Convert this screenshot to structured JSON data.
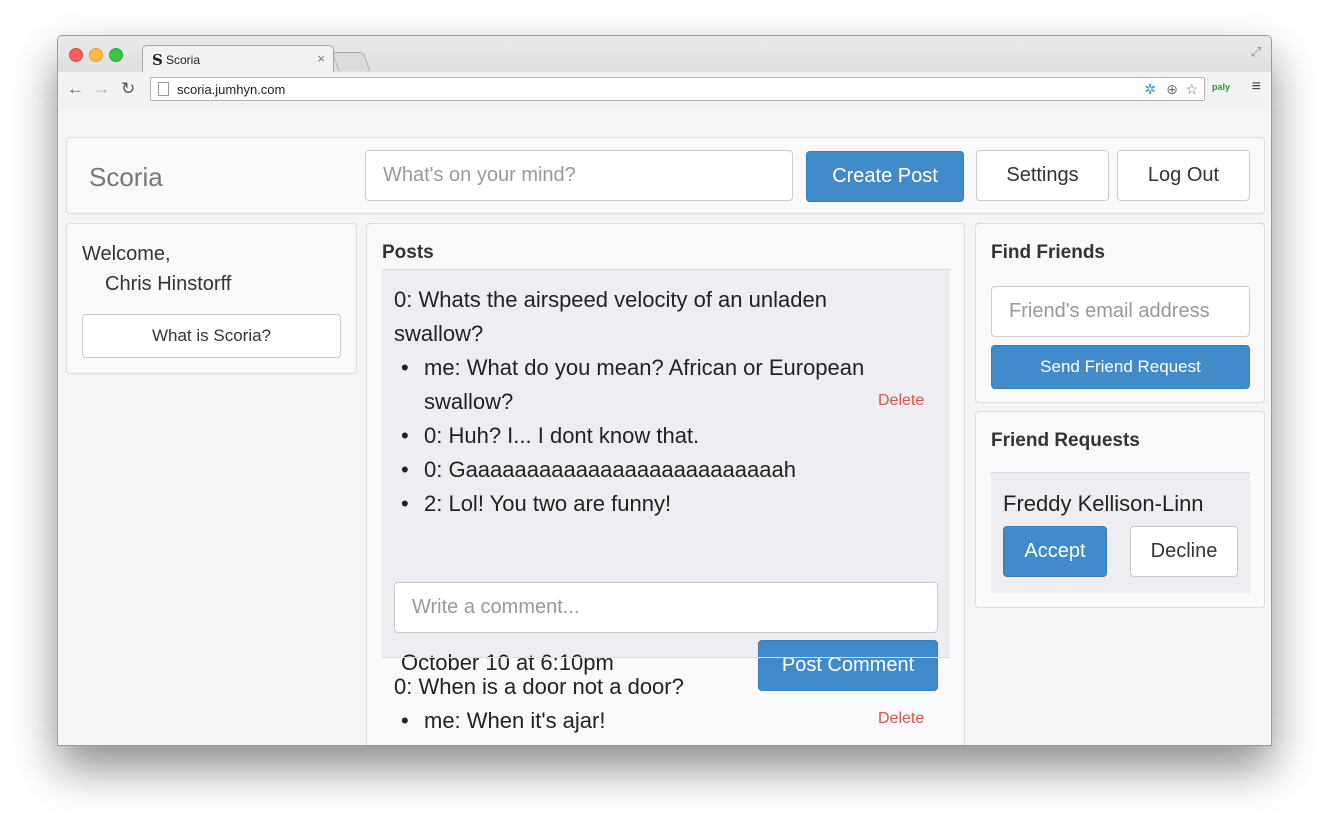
{
  "browser": {
    "tab_favicon": "S",
    "tab_title": "Scoria",
    "tab_close": "×",
    "url": "scoria.jumhyn.com",
    "extension_label": "paly"
  },
  "navbar": {
    "brand": "Scoria",
    "post_placeholder": "What's on your mind?",
    "create_post_label": "Create Post",
    "settings_label": "Settings",
    "logout_label": "Log Out"
  },
  "sidebar": {
    "welcome": "Welcome,",
    "user_name": "Chris Hinstorff",
    "about_button": "What is Scoria?"
  },
  "posts": {
    "title": "Posts",
    "items": [
      {
        "text": "0: Whats the airspeed velocity of an unladen swallow?",
        "comments": [
          {
            "text": "me: What do you mean? African or European swallow?",
            "delete_label": "Delete"
          },
          {
            "text": "0: Huh? I... I dont know that."
          },
          {
            "text": "0: Gaaaaaaaaaaaaaaaaaaaaaaaaaah"
          },
          {
            "text": "2: Lol! You two are funny!"
          }
        ],
        "comment_placeholder": "Write a comment...",
        "date": "October 10 at 6:10pm",
        "post_comment_label": "Post Comment"
      },
      {
        "text": "0: When is a door not a door?",
        "comments": [
          {
            "text": "me: When it's ajar!",
            "delete_label": "Delete"
          }
        ]
      }
    ]
  },
  "find_friends": {
    "title": "Find Friends",
    "email_placeholder": "Friend's email address",
    "send_label": "Send Friend Request"
  },
  "friend_requests": {
    "title": "Friend Requests",
    "items": [
      {
        "name": "Freddy Kellison-Linn",
        "accept_label": "Accept",
        "decline_label": "Decline"
      }
    ]
  },
  "colors": {
    "primary": "#428bca",
    "delete": "#d9534f",
    "page_bg": "#f5f5f8"
  }
}
